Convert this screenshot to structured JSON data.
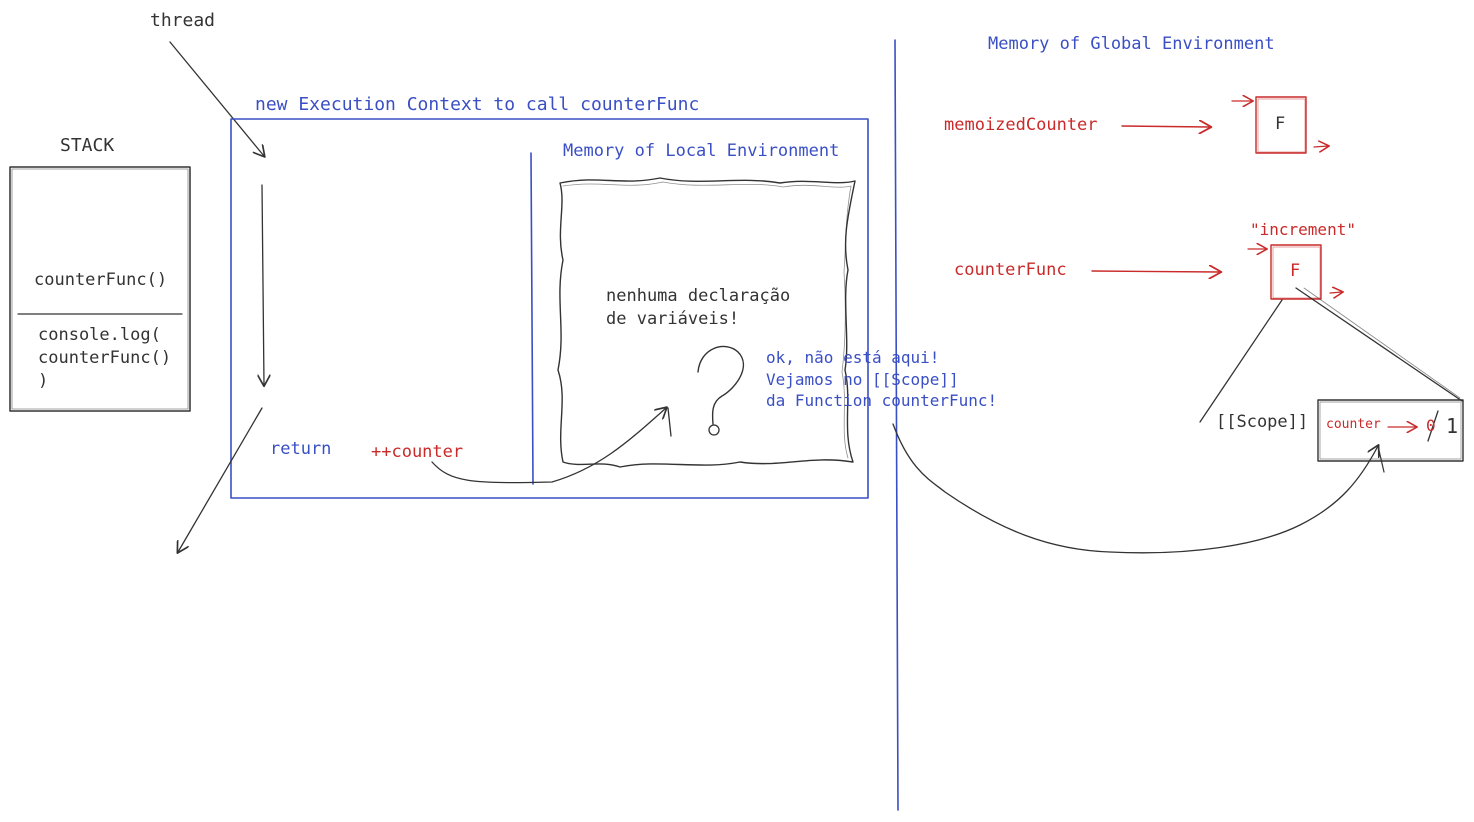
{
  "thread_label": "thread",
  "stack": {
    "title": "STACK",
    "frames": [
      "counterFunc()",
      "console.log(\ncounterFunc()\n)"
    ]
  },
  "execution_context": {
    "title": "new Execution Context to call counterFunc",
    "return_label": "return",
    "expression": "++counter"
  },
  "local_memory": {
    "title": "Memory of Local Environment",
    "note": "nenhuma declaração\nde variáveis!",
    "question_mark": "?",
    "lookup_note": "ok, não está aqui!\nVejamos no [[Scope]]\nda Function counterFunc!"
  },
  "global_memory": {
    "title": "Memory of Global Environment",
    "entries": [
      {
        "name": "memoizedCounter",
        "value": "F"
      },
      {
        "name": "counterFunc",
        "value": "F",
        "function_name": "\"increment\""
      }
    ],
    "scope_label": "[[Scope]]",
    "scope_variable": "counter",
    "scope_old_value": "0",
    "scope_new_value": "1"
  },
  "colors": {
    "ink": "#333333",
    "blue": "#3a4fc4",
    "red": "#c92a2a"
  }
}
